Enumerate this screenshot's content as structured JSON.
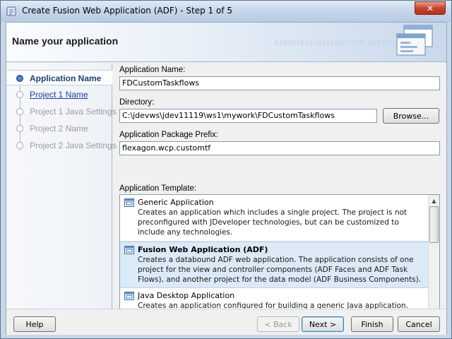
{
  "window": {
    "title": "Create Fusion Web Application (ADF) - Step 1 of 5",
    "close_label": "✕"
  },
  "header": {
    "title": "Name your application",
    "watermark": "010101010101010101010  01010101"
  },
  "nav": {
    "items": [
      {
        "label": "Application Name",
        "state": "active"
      },
      {
        "label": "Project 1 Name",
        "state": "link"
      },
      {
        "label": "Project 1 Java Settings",
        "state": "disabled"
      },
      {
        "label": "Project 2 Name",
        "state": "disabled"
      },
      {
        "label": "Project 2 Java Settings",
        "state": "disabled"
      }
    ]
  },
  "form": {
    "app_name_label": "Application Name:",
    "app_name_value": "FDCustomTaskflows",
    "directory_label": "Directory:",
    "directory_value": "C:\\jdevws\\jdev11119\\ws1\\mywork\\FDCustomTaskflows",
    "browse_label": "Browse...",
    "package_label": "Application Package Prefix:",
    "package_value": "flexagon.wcp.customtf",
    "template_label": "Application Template:"
  },
  "templates": [
    {
      "title": "Generic Application",
      "description": "Creates an application which includes a single project. The project is not preconfigured with JDeveloper technologies, but can be customized to include any technologies."
    },
    {
      "title": "Fusion Web Application (ADF)",
      "description": "Creates a databound ADF web application. The application consists of one project for the view and controller components (ADF Faces and ADF Task Flows), and another project for the data model (ADF Business Components)."
    },
    {
      "title": "Java Desktop Application",
      "description": "Creates an application configured for building a generic Java application. The new application will include a project that is preconfigured to use Java, Swing, and JavaBeans technologies."
    }
  ],
  "footer": {
    "help": "Help",
    "back": "< Back",
    "next": "Next >",
    "finish": "Finish",
    "cancel": "Cancel"
  }
}
